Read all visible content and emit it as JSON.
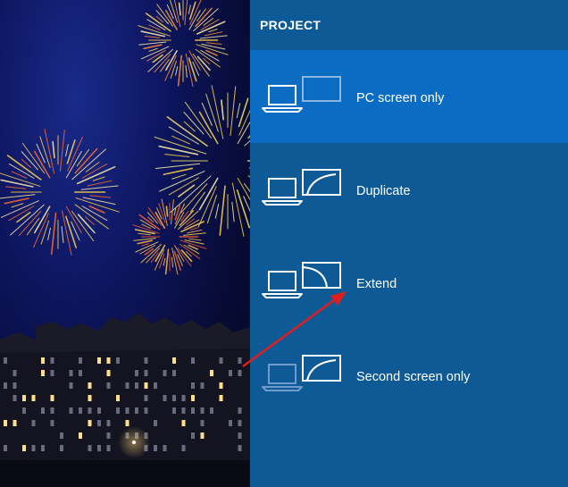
{
  "panel": {
    "title": "PROJECT",
    "options": [
      {
        "label": "PC screen only",
        "icon": "pc-screen-only-icon",
        "selected": true
      },
      {
        "label": "Duplicate",
        "icon": "duplicate-icon",
        "selected": false
      },
      {
        "label": "Extend",
        "icon": "extend-icon",
        "selected": false
      },
      {
        "label": "Second screen only",
        "icon": "second-screen-only-icon",
        "selected": false
      }
    ]
  },
  "colors": {
    "panel_bg": "#0e5a96",
    "selected_bg": "#0a6cc2",
    "annotation_arrow": "#e11d1d"
  },
  "wallpaper": {
    "subject": "fireworks over canal houses at night"
  }
}
